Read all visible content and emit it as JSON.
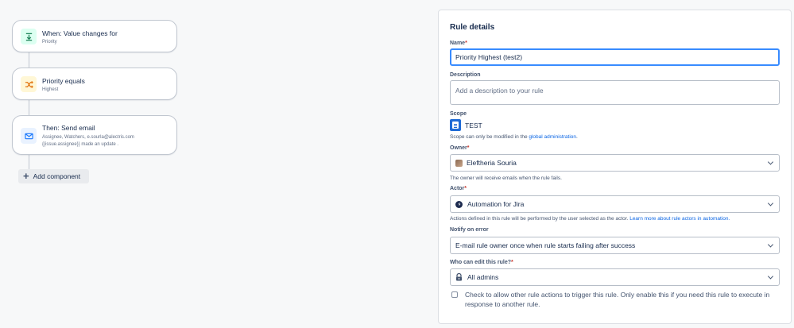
{
  "flow": {
    "trigger": {
      "title": "When: Value changes for",
      "sub": "Priority"
    },
    "condition": {
      "title": "Priority equals",
      "sub": "Highest"
    },
    "action": {
      "title": "Then: Send email",
      "sub_line1": "Assignee, Watchers, e.sourla@alectris.com",
      "sub_line2": "{{issue.assignee}} made an update ."
    },
    "add_component_label": "Add component"
  },
  "rule_details": {
    "heading": "Rule details",
    "name": {
      "label": "Name",
      "required": "*",
      "value": "Priority Highest (test2)"
    },
    "description": {
      "label": "Description",
      "placeholder": "Add a description to your rule"
    },
    "scope": {
      "label": "Scope",
      "value": "TEST",
      "help_prefix": "Scope can only be modified in the ",
      "help_link": "global administration",
      "help_suffix": "."
    },
    "owner": {
      "label": "Owner",
      "required": "*",
      "value": "Eleftheria Souria",
      "help": "The owner will receive emails when the rule fails."
    },
    "actor": {
      "label": "Actor",
      "required": "*",
      "value": "Automation for Jira",
      "help_prefix": "Actions defined in this rule will be performed by the user selected as the actor. ",
      "help_link": "Learn more about rule actors in automation."
    },
    "notify": {
      "label": "Notify on error",
      "value": "E-mail rule owner once when rule starts failing after success"
    },
    "editors": {
      "label": "Who can edit this rule?",
      "required": "*",
      "value": "All admins"
    },
    "allow_trigger": {
      "text": "Check to allow other rule actions to trigger this rule. Only enable this if you need this rule to execute in response to another rule.",
      "checked": false
    }
  },
  "colors": {
    "trigger_icon_bg": "#dcfff1",
    "trigger_icon_fg": "#1f845a",
    "condition_icon_bg": "#fff7d6",
    "condition_icon_fg": "#e2740f",
    "action_icon_bg": "#e9f2ff",
    "action_icon_fg": "#1d7afc",
    "link": "#0c66e4",
    "focus_border": "#388bff"
  }
}
